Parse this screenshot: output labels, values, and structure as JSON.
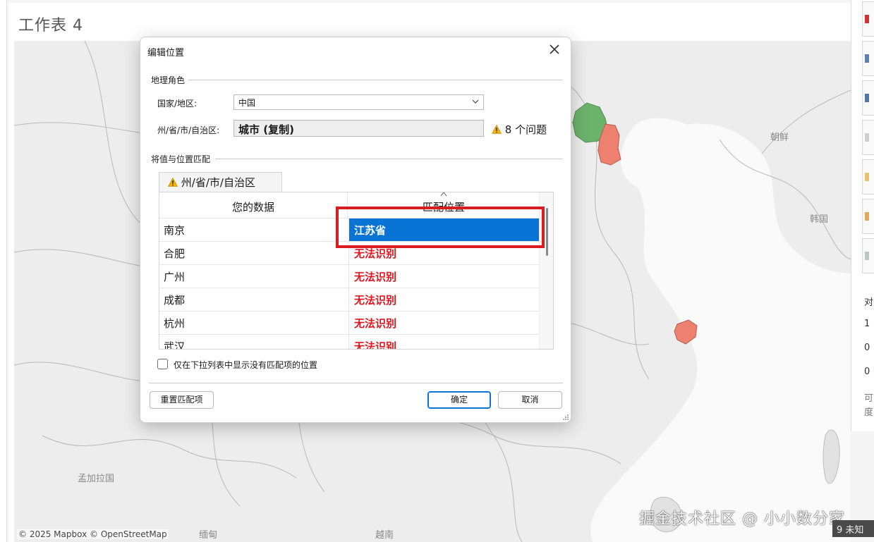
{
  "worksheet": {
    "title": "工作表 4"
  },
  "map": {
    "labels": [
      "朝鲜",
      "韩国",
      "孟加拉国",
      "缅甸",
      "越南"
    ],
    "credit": "© 2025 Mapbox © OpenStreetMap"
  },
  "watermark": "掘金技术社区 @ 小小数分家",
  "unknown_badge": "9 未知",
  "right_panel": {
    "texts": [
      "对",
      "1",
      "0",
      "0",
      "可",
      "度"
    ]
  },
  "dialog": {
    "title": "编辑位置",
    "geo_role_group": "地理角色",
    "country_label": "国家/地区:",
    "country_value": "中国",
    "state_label": "州/省/市/自治区:",
    "state_value": "城市 (复制)",
    "issues_text": "8 个问题",
    "match_group": "将值与位置匹配",
    "tab_label": "州/省/市/自治区",
    "table": {
      "headers": [
        "您的数据",
        "匹配位置"
      ],
      "rows": [
        {
          "data": "南京",
          "match": "江苏省"
        },
        {
          "data": "合肥",
          "match": "无法识别"
        },
        {
          "data": "广州",
          "match": "无法识别"
        },
        {
          "data": "成都",
          "match": "无法识别"
        },
        {
          "data": "杭州",
          "match": "无法识别"
        },
        {
          "data": "武汉",
          "match": "无法识别"
        }
      ]
    },
    "checkbox_label": "仅在下拉列表中显示没有匹配项的位置",
    "reset_button": "重置匹配项",
    "ok_button": "确定",
    "cancel_button": "取消"
  },
  "colors": {
    "selection": "#0a74d6",
    "unrecognized": "#e0141e",
    "highlight_border": "#d91c22",
    "region_green": "#6bb26b",
    "region_red": "#ee8070"
  }
}
